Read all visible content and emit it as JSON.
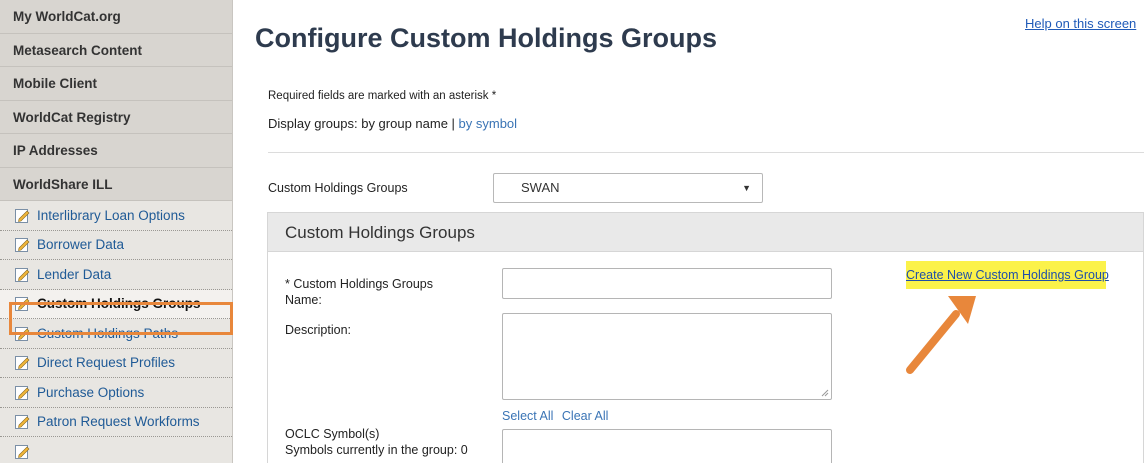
{
  "sidebar": {
    "sections": [
      "My WorldCat.org",
      "Metasearch Content",
      "Mobile Client",
      "WorldCat Registry",
      "IP Addresses",
      "WorldShare ILL"
    ],
    "items": [
      "Interlibrary Loan Options",
      "Borrower Data",
      "Lender Data",
      "Custom Holdings Groups",
      "Custom Holdings Paths",
      "Direct Request Profiles",
      "Purchase Options",
      "Patron Request Workforms"
    ],
    "active_item": "Custom Holdings Groups",
    "highlight_color": "#e8873b"
  },
  "header": {
    "title": "Configure Custom Holdings Groups",
    "help_link": "Help on this screen"
  },
  "intro": {
    "required_note": "Required fields are marked with an asterisk *",
    "display_groups_prefix": "Display groups: by group name | ",
    "by_symbol_link": "by symbol"
  },
  "groups_select": {
    "label": "Custom Holdings Groups",
    "value": "SWAN"
  },
  "panel": {
    "title": "Custom Holdings Groups",
    "name_label_line1": "* Custom Holdings Groups",
    "name_label_line2": "Name:",
    "description_label": "Description:",
    "symbols_label": "OCLC Symbol(s)",
    "symbols_count": "Symbols currently in the group: 0",
    "select_all": "Select All",
    "clear_all": "Clear All",
    "create_link": "Create New Custom Holdings Group",
    "create_highlight_color": "#fbf24a",
    "arrow_color": "#e8873b"
  }
}
